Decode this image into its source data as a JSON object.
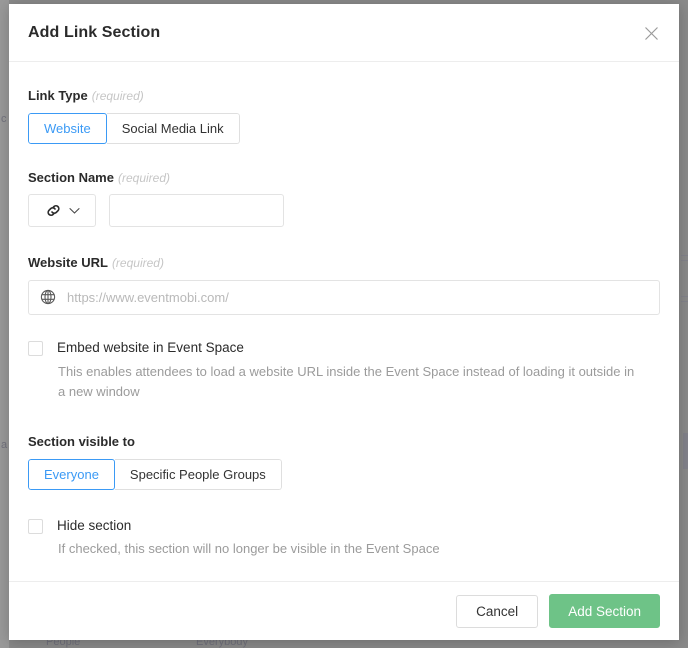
{
  "modal": {
    "title": "Add Link Section",
    "close_icon": "close-icon"
  },
  "colors": {
    "accent_blue": "#3b9af5",
    "primary_green": "#6ec387",
    "label_text": "#2b2b2b",
    "muted_text": "#9b9b9b",
    "placeholder_text": "#b9b9b9",
    "border": "#e3e3e3"
  },
  "fields": {
    "link_type": {
      "label": "Link Type",
      "required_note": "(required)",
      "options": [
        "Website",
        "Social Media Link"
      ],
      "selected": "Website"
    },
    "section_name": {
      "label": "Section Name",
      "required_note": "(required)",
      "icon": "link-icon",
      "dropdown_icon": "chevron-down-icon",
      "value": "",
      "placeholder": ""
    },
    "website_url": {
      "label": "Website URL",
      "required_note": "(required)",
      "icon": "globe-icon",
      "value": "",
      "placeholder": "https://www.eventmobi.com/"
    },
    "embed_website": {
      "label": "Embed website in Event Space",
      "checked": false,
      "help": "This enables attendees to load a website URL inside the Event Space instead of loading it outside in a new window"
    },
    "section_visible_to": {
      "label": "Section visible to",
      "options": [
        "Everyone",
        "Specific People Groups"
      ],
      "selected": "Everyone"
    },
    "hide_section": {
      "label": "Hide section",
      "checked": false,
      "help": "If checked, this section will no longer be visible in the Event Space"
    }
  },
  "footer": {
    "cancel_label": "Cancel",
    "submit_label": "Add Section"
  },
  "background": {
    "fragment_left": "c",
    "fragment_left_lower": "a",
    "fragment_bottom_left": "People",
    "fragment_bottom_mid": "Everybody"
  }
}
